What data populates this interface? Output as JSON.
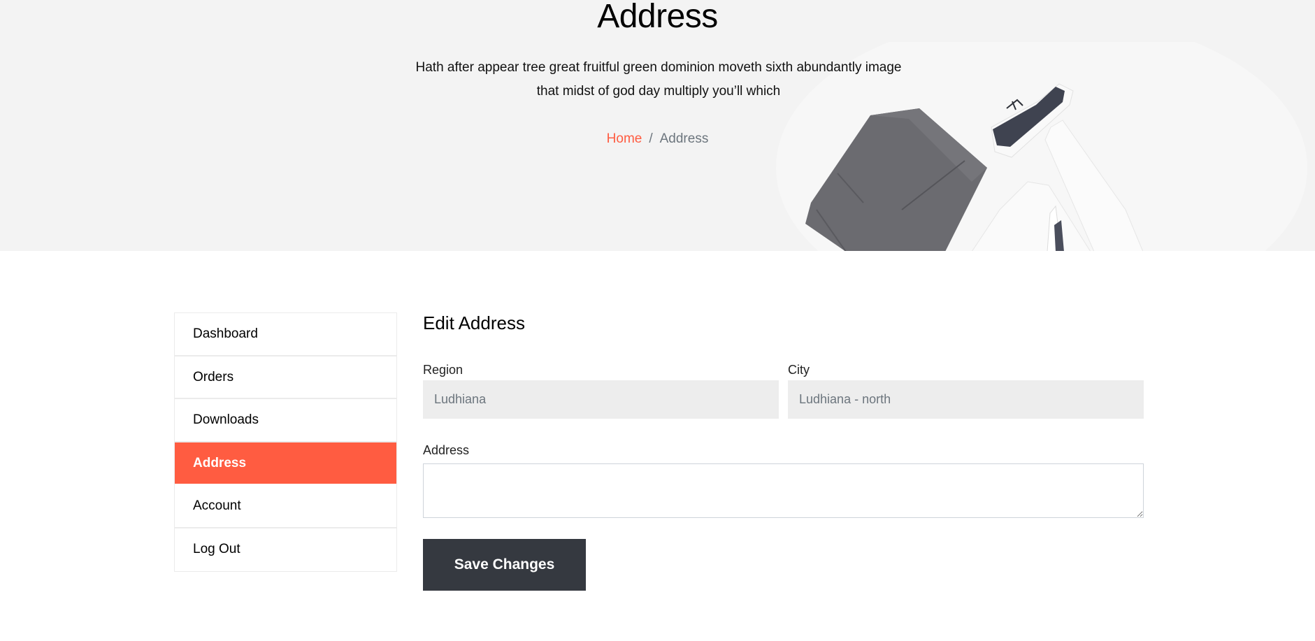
{
  "hero": {
    "title": "Address",
    "subtitle": "Hath after appear tree great fruitful green dominion moveth sixth abundantly image that midst of god day multiply you’ll which",
    "breadcrumb": {
      "home": "Home",
      "separator": "/",
      "current": "Address"
    },
    "image": "clothing-flatlay-pants-sneakers-shirt"
  },
  "sidebar": {
    "items": [
      {
        "label": "Dashboard",
        "active": false
      },
      {
        "label": "Orders",
        "active": false
      },
      {
        "label": "Downloads",
        "active": false
      },
      {
        "label": "Address",
        "active": true
      },
      {
        "label": "Account",
        "active": false
      },
      {
        "label": "Log Out",
        "active": false
      }
    ]
  },
  "form": {
    "title": "Edit Address",
    "region": {
      "label": "Region",
      "value": "Ludhiana"
    },
    "city": {
      "label": "City",
      "value": "Ludhiana - north"
    },
    "address": {
      "label": "Address",
      "value": ""
    },
    "save_label": "Save Changes"
  },
  "colors": {
    "accent": "#ff5c41",
    "button_dark": "#353940",
    "hero_bg": "#f3f3f3",
    "input_bg": "#ededed"
  }
}
